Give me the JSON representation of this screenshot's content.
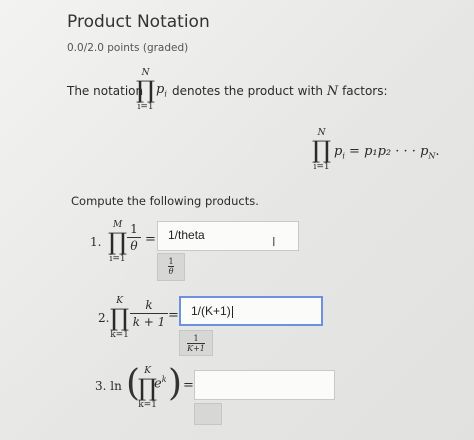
{
  "header": {
    "title": "Product Notation",
    "points": "0.0/2.0 points (graded)"
  },
  "intro": {
    "lead": "The notation",
    "prod_upper": "N",
    "prod_lower": "i=1",
    "term": "p",
    "term_sub": "i",
    "rest": "denotes the product with",
    "n_var": "N",
    "tail": "factors:"
  },
  "definition": {
    "prod_upper": "N",
    "prod_lower": "i=1",
    "lhs": "p",
    "lhs_sub": "i",
    "equals": "=",
    "rhs": "p₁p₂ · · · p",
    "rhs_sub": "N",
    "period": "."
  },
  "instructions": "Compute the following products.",
  "questions": [
    {
      "number": "1.",
      "prod_upper": "M",
      "prod_lower": "i=1",
      "numerator": "1",
      "denominator": "θ",
      "equals": "=",
      "answer": "1/theta",
      "preview_num": "1",
      "preview_den": "θ"
    },
    {
      "number": "2.",
      "prod_upper": "K",
      "prod_lower": "k=1",
      "numerator": "k",
      "denominator": "k + 1",
      "equals": "=",
      "answer": "1/(K+1)",
      "preview_num": "1",
      "preview_den": "K+1"
    },
    {
      "number": "3.",
      "func": "ln",
      "prod_upper": "K",
      "prod_lower": "k=1",
      "base": "e",
      "exponent": "k",
      "equals": "=",
      "answer": "",
      "preview_num": "",
      "preview_den": ""
    }
  ],
  "icons": {
    "text_cursor": "text-cursor-icon"
  }
}
